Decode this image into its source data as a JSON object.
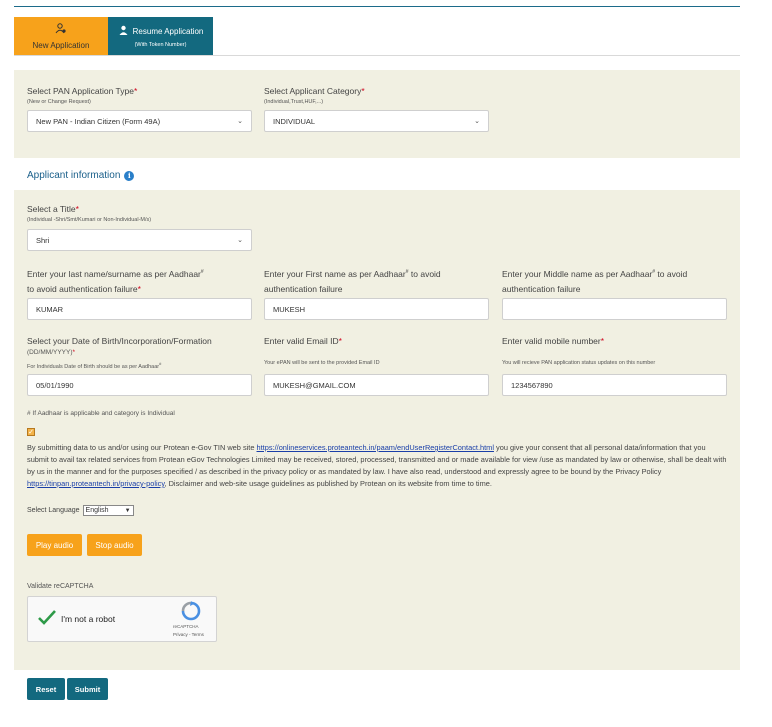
{
  "tabs": {
    "new": {
      "label": "New Application",
      "icon": "person-add-icon"
    },
    "resume": {
      "label": "Resume Application",
      "sublabel": "(With Token Number)",
      "icon": "person-resume-icon"
    }
  },
  "pan_type": {
    "label": "Select PAN Application Type",
    "hint": "(New or Change Request)",
    "value": "New PAN - Indian Citizen (Form 49A)"
  },
  "category": {
    "label": "Select Applicant Category",
    "hint": "(Individual,Trust,HUF,...)",
    "value": "INDIVIDUAL"
  },
  "section": {
    "title": "Applicant information"
  },
  "title_field": {
    "label": "Select a Title",
    "hint": "(Individual -Shri/Smt/Kumari or Non-Individual-M/s)",
    "value": "Shri"
  },
  "last_name": {
    "label_line1": "Enter your last name/surname as per Aadhaar",
    "label_line2": "to avoid authentication failure",
    "value": "KUMAR"
  },
  "first_name": {
    "label_line1": "Enter your First name as per Aadhaar",
    "label_line2": "authentication failure",
    "label_after": " to avoid",
    "value": "MUKESH"
  },
  "middle_name": {
    "label_line1": "Enter your Middle name as per Aadhaar",
    "label_line2": "authentication failure",
    "label_after": " to avoid",
    "value": ""
  },
  "dob": {
    "label": "Select your Date of Birth/Incorporation/Formation",
    "format": "(DD/MM/YYYY)",
    "hint": "For Individuals Date of Birth should be as per Aadhaar",
    "value": "05/01/1990"
  },
  "email": {
    "label": "Enter valid Email ID",
    "hint": "Your ePAN will be sent to the provided Email ID",
    "value": "MUKESH@GMAIL.COM"
  },
  "mobile": {
    "label": "Enter valid mobile number",
    "hint": "You will recieve PAN application status updates on this number",
    "value": "1234567890"
  },
  "aadhaar_note": "# If Aadhaar is applicable and category is Individual",
  "consent": {
    "checked": true,
    "part1": "By submitting data to us and/or using our Protean e-Gov TIN web site ",
    "link1": "https://onlineservices.proteantech.in/paam/endUserRegisterContact.html",
    "part2": " you give your consent that all personal data/information that you submit to avail tax related services from Protean eGov Technologies Limited may be received, stored, processed, transmitted and or made available for view /use as mandated by law or otherwise, shall be dealt with by us in the manner and for the purposes specified / as described in the privacy policy or as mandated by law. I have also read, understood and expressly agree to be bound by the Privacy Policy ",
    "link2": "https://tinpan.proteantech.in/privacy-policy",
    "part3": ", Disclaimer and web-site usage guidelines as published by Protean on its website from time to time."
  },
  "language": {
    "label": "Select Language",
    "value": "English"
  },
  "audio": {
    "play": "Play audio",
    "stop": "Stop audio"
  },
  "captcha": {
    "label": "Validate reCAPTCHA",
    "checkbox_text": "I'm not a robot",
    "brand": "reCAPTCHA",
    "links": "Privacy - Terms"
  },
  "actions": {
    "reset": "Reset",
    "submit": "Submit"
  },
  "colors": {
    "accent_orange": "#f7a21b",
    "accent_teal": "#13697f",
    "panel": "#f1f0e2"
  }
}
